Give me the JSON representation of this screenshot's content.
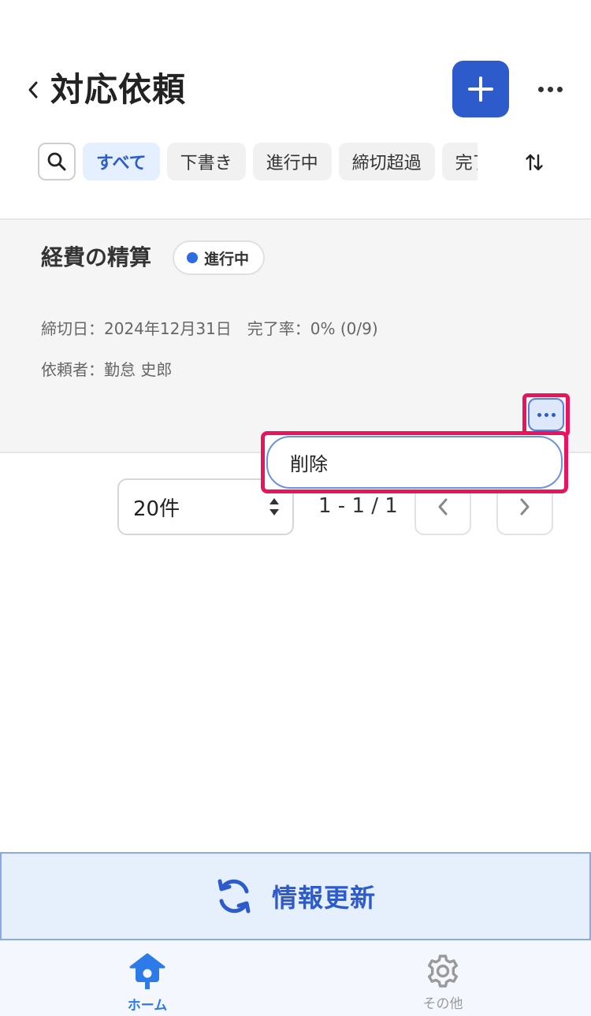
{
  "header": {
    "back_icon": "chevron-left-icon",
    "title": "対応依頼",
    "add_icon": "plus-icon",
    "more_icon": "ellipsis-icon"
  },
  "filters": {
    "search_icon": "search-icon",
    "chips": [
      "すべて",
      "下書き",
      "進行中",
      "締切超過",
      "完了"
    ],
    "active_chip": "すべて",
    "sort_icon": "sort-icon"
  },
  "card": {
    "title": "経費の精算",
    "status": "進行中",
    "status_color": "#2d6be4",
    "deadline_line": "締切日：2024年12月31日　完了率：0% (0/9)",
    "requester_line": "依頼者：勤怠 史郎",
    "more_icon": "ellipsis-icon"
  },
  "menu": {
    "delete_label": "削除"
  },
  "pagination": {
    "per_page": "20件",
    "range": "1 - 1 / 1",
    "prev_icon": "chevron-left-icon",
    "next_icon": "chevron-right-icon"
  },
  "refresh": {
    "label": "情報更新",
    "icon": "refresh-icon"
  },
  "bottom_nav": {
    "home_label": "ホーム",
    "other_label": "その他",
    "home_icon": "birdhouse-icon",
    "other_icon": "gear-icon"
  },
  "colors": {
    "primary": "#2d5bcc",
    "highlight": "#e8145f",
    "nav_active": "#2d7be8"
  }
}
